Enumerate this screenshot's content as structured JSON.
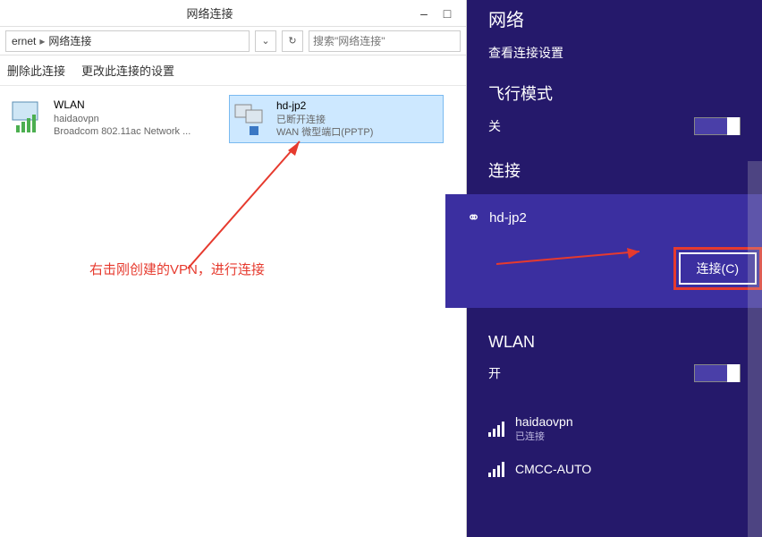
{
  "window": {
    "title": "网络连接",
    "minimize": "–",
    "maximize": "□"
  },
  "breadcrumb": {
    "part1": "ernet",
    "part2": "网络连接"
  },
  "search": {
    "placeholder": "搜索\"网络连接\""
  },
  "toolbar": {
    "delete": "删除此连接",
    "change": "更改此连接的设置"
  },
  "connections": {
    "wlan": {
      "name": "WLAN",
      "ssid": "haidaovpn",
      "adapter": "Broadcom 802.11ac Network ..."
    },
    "vpn": {
      "name": "hd-jp2",
      "status": "已断开连接",
      "type": "WAN 微型端口(PPTP)"
    }
  },
  "annotation": "右击刚创建的VPN，进行连接",
  "charm": {
    "title": "网络",
    "view_settings": "查看连接设置",
    "airplane": {
      "label": "飞行模式",
      "state": "关"
    },
    "connections_label": "连接",
    "vpn_name": "hd-jp2",
    "connect_btn": "连接(C)",
    "wlan_label": "WLAN",
    "wlan_state": "开",
    "wifi": [
      {
        "name": "haidaovpn",
        "status": "已连接"
      },
      {
        "name": "CMCC-AUTO",
        "status": ""
      }
    ]
  }
}
